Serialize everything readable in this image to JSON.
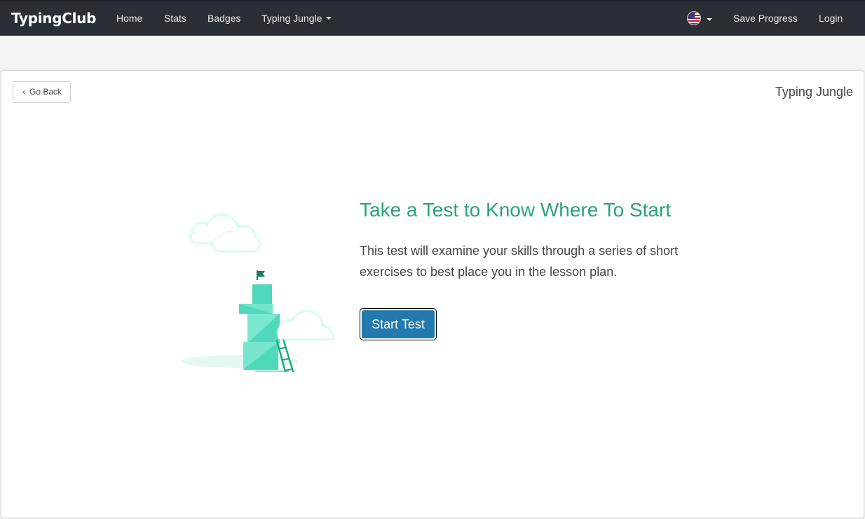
{
  "navbar": {
    "brand": "TypingClub",
    "links": [
      {
        "label": "Home"
      },
      {
        "label": "Stats"
      },
      {
        "label": "Badges"
      },
      {
        "label": "Typing Jungle"
      }
    ],
    "language_icon": "us-flag-icon",
    "save_progress": "Save Progress",
    "login": "Login"
  },
  "card": {
    "go_back": "Go Back",
    "course_title": "Typing Jungle",
    "headline": "Take a Test to Know Where To Start",
    "description": "This test will examine your skills through a series of short exercises to best place you in the lesson plan.",
    "start_button": "Start Test"
  },
  "colors": {
    "navbar_bg": "#2a2f35",
    "accent_green": "#2aa37c",
    "button_blue": "#2279ad",
    "tower_teal": "#4fd8bb"
  }
}
